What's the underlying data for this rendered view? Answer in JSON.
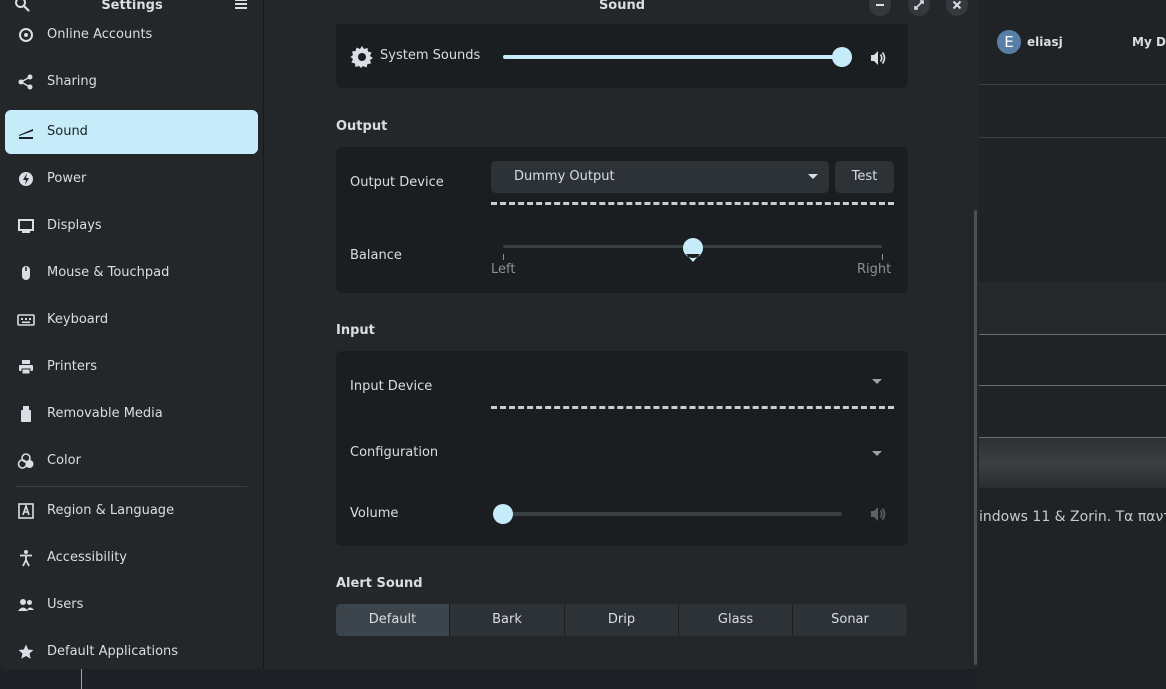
{
  "sidebar": {
    "title": "Settings",
    "items": [
      {
        "label": "Online Accounts",
        "icon": "online-accounts-icon"
      },
      {
        "label": "Sharing",
        "icon": "share-icon"
      },
      {
        "label": "Sound",
        "icon": "sound-icon",
        "active": true
      },
      {
        "label": "Power",
        "icon": "power-icon"
      },
      {
        "label": "Displays",
        "icon": "display-icon"
      },
      {
        "label": "Mouse & Touchpad",
        "icon": "mouse-icon"
      },
      {
        "label": "Keyboard",
        "icon": "keyboard-icon"
      },
      {
        "label": "Printers",
        "icon": "printer-icon"
      },
      {
        "label": "Removable Media",
        "icon": "removable-media-icon"
      },
      {
        "label": "Color",
        "icon": "color-icon"
      },
      {
        "label": "Region & Language",
        "icon": "region-icon"
      },
      {
        "label": "Accessibility",
        "icon": "accessibility-icon"
      },
      {
        "label": "Users",
        "icon": "users-icon"
      },
      {
        "label": "Default Applications",
        "icon": "star-icon"
      }
    ]
  },
  "main": {
    "title": "Sound",
    "system_sounds": {
      "label": "System Sounds",
      "level": 1.0
    },
    "output": {
      "section": "Output",
      "device_label": "Output Device",
      "device_value": "Dummy Output",
      "test_label": "Test",
      "balance_label": "Balance",
      "balance_value": 0.5,
      "left_label": "Left",
      "right_label": "Right"
    },
    "input": {
      "section": "Input",
      "device_label": "Input Device",
      "configuration_label": "Configuration",
      "volume_label": "Volume",
      "volume_level": 0.0
    },
    "alert": {
      "section": "Alert Sound",
      "options": [
        "Default",
        "Bark",
        "Drip",
        "Glass",
        "Sonar"
      ],
      "selected": "Default"
    }
  },
  "background_window": {
    "avatar_letter": "E",
    "user": "eliasj",
    "tab": "My Da",
    "text": "indows 11 & Zorin. Τα παντ"
  },
  "colors": {
    "accent": "#c6ecf9",
    "window_bg": "#23272a",
    "card_bg": "#1b1e21"
  }
}
